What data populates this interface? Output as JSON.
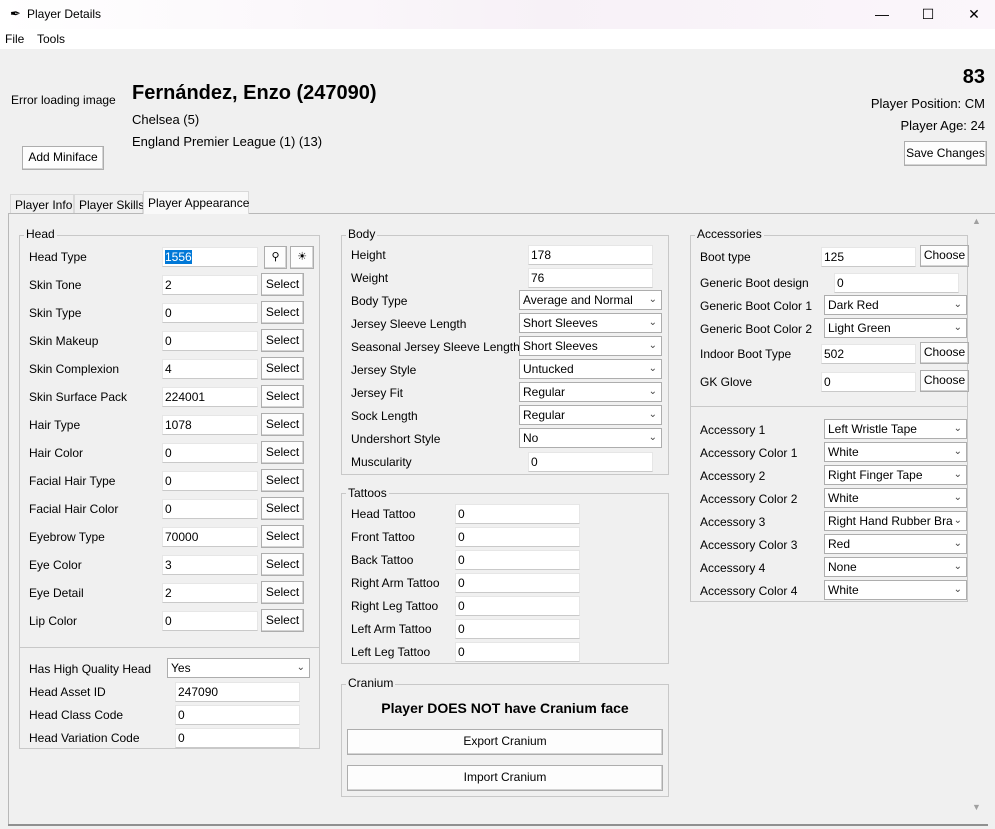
{
  "window": {
    "title": "Player Details",
    "minimize_glyph": "—",
    "maximize_glyph": "☐",
    "close_glyph": "✕"
  },
  "menu": {
    "file": "File",
    "tools": "Tools"
  },
  "header": {
    "image_error": "Error loading image",
    "add_miniface": "Add Miniface",
    "player_name": "Fernández, Enzo (247090)",
    "club": "Chelsea (5)",
    "league": "England Premier League (1) (13)",
    "rating": "83",
    "position": "Player Position: CM",
    "age": "Player Age: 24",
    "save_changes": "Save Changes"
  },
  "tabs": [
    "Player Info",
    "Player Skills",
    "Player Appearance"
  ],
  "head": {
    "title": "Head",
    "select_label": "Select",
    "head_type": {
      "label": "Head Type",
      "value": "1556"
    },
    "rows": [
      {
        "label": "Skin Tone",
        "value": "2"
      },
      {
        "label": "Skin Type",
        "value": "0"
      },
      {
        "label": "Skin Makeup",
        "value": "0"
      },
      {
        "label": "Skin Complexion",
        "value": "4"
      },
      {
        "label": "Skin Surface Pack",
        "value": "224001"
      },
      {
        "label": "Hair Type",
        "value": "1078"
      },
      {
        "label": "Hair Color",
        "value": "0"
      },
      {
        "label": "Facial Hair Type",
        "value": "0"
      },
      {
        "label": "Facial Hair Color",
        "value": "0"
      },
      {
        "label": "Eyebrow Type",
        "value": "70000"
      },
      {
        "label": "Eye Color",
        "value": "3"
      },
      {
        "label": "Eye Detail",
        "value": "2"
      },
      {
        "label": "Lip Color",
        "value": "0"
      }
    ],
    "hq_head": {
      "label": "Has High Quality Head",
      "value": "Yes"
    },
    "asset_id": {
      "label": "Head Asset ID",
      "value": "247090"
    },
    "class_code": {
      "label": "Head Class Code",
      "value": "0"
    },
    "variation_code": {
      "label": "Head Variation Code",
      "value": "0"
    }
  },
  "body": {
    "title": "Body",
    "height": {
      "label": "Height",
      "value": "178"
    },
    "weight": {
      "label": "Weight",
      "value": "76"
    },
    "combos": [
      {
        "label": "Body Type",
        "value": "Average and Normal"
      },
      {
        "label": "Jersey Sleeve Length",
        "value": "Short Sleeves"
      },
      {
        "label": "Seasonal Jersey Sleeve Length",
        "value": "Short Sleeves"
      },
      {
        "label": "Jersey Style",
        "value": "Untucked"
      },
      {
        "label": "Jersey Fit",
        "value": "Regular"
      },
      {
        "label": "Sock Length",
        "value": "Regular"
      },
      {
        "label": "Undershort Style",
        "value": "No"
      }
    ],
    "muscularity": {
      "label": "Muscularity",
      "value": "0"
    }
  },
  "tattoos": {
    "title": "Tattoos",
    "rows": [
      {
        "label": "Head Tattoo",
        "value": "0"
      },
      {
        "label": "Front Tattoo",
        "value": "0"
      },
      {
        "label": "Back Tattoo",
        "value": "0"
      },
      {
        "label": "Right Arm Tattoo",
        "value": "0"
      },
      {
        "label": "Right Leg Tattoo",
        "value": "0"
      },
      {
        "label": "Left Arm Tattoo",
        "value": "0"
      },
      {
        "label": "Left Leg Tattoo",
        "value": "0"
      }
    ]
  },
  "cranium": {
    "title": "Cranium",
    "status": "Player DOES NOT have Cranium face",
    "export": "Export Cranium",
    "import": "Import Cranium"
  },
  "accessories": {
    "title": "Accessories",
    "choose_label": "Choose",
    "boot_type": {
      "label": "Boot type",
      "value": "125"
    },
    "generic_boot_design": {
      "label": "Generic Boot design",
      "value": "0"
    },
    "generic_boot_color1": {
      "label": "Generic Boot Color 1",
      "value": "Dark Red"
    },
    "generic_boot_color2": {
      "label": "Generic Boot Color 2",
      "value": "Light Green"
    },
    "indoor_boot_type": {
      "label": "Indoor Boot Type",
      "value": "502"
    },
    "gk_glove": {
      "label": "GK Glove",
      "value": "0"
    },
    "rows": [
      {
        "label": "Accessory 1",
        "value": "Left Wristle Tape"
      },
      {
        "label": "Accessory Color 1",
        "value": "White"
      },
      {
        "label": "Accessory 2",
        "value": "Right Finger Tape"
      },
      {
        "label": "Accessory Color 2",
        "value": "White"
      },
      {
        "label": "Accessory 3",
        "value": "Right Hand Rubber Bra"
      },
      {
        "label": "Accessory Color 3",
        "value": "Red"
      },
      {
        "label": "Accessory 4",
        "value": "None"
      },
      {
        "label": "Accessory Color 4",
        "value": "White"
      }
    ]
  },
  "icons": {
    "app": "feather-icon",
    "eyedropper": "eyedropper-icon",
    "bug": "bug-icon",
    "dropdown": "chevron-down-icon"
  },
  "colors": {
    "selection": "#0078d7",
    "window_bg": "#f0f0f0"
  }
}
